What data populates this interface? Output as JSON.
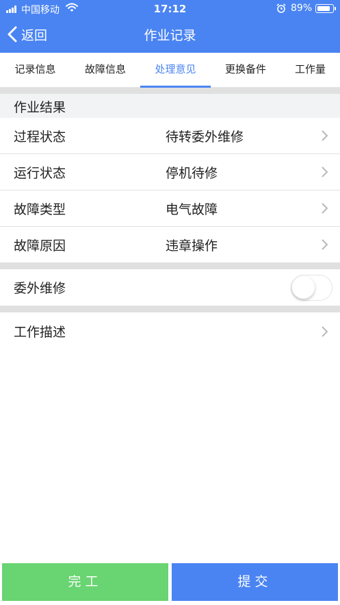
{
  "status_bar": {
    "carrier": "中国移动",
    "time": "17:12",
    "battery": "89%",
    "battery_level": 0.89
  },
  "nav": {
    "back_label": "返回",
    "title": "作业记录"
  },
  "tabs": [
    {
      "label": "记录信息",
      "active": false
    },
    {
      "label": "故障信息",
      "active": false
    },
    {
      "label": "处理意见",
      "active": true
    },
    {
      "label": "更换备件",
      "active": false
    },
    {
      "label": "工作量",
      "active": false
    }
  ],
  "work_result": {
    "header": "作业结果",
    "rows": [
      {
        "label": "过程状态",
        "value": "待转委外维修"
      },
      {
        "label": "运行状态",
        "value": "停机待修"
      },
      {
        "label": "故障类型",
        "value": "电气故障"
      },
      {
        "label": "故障原因",
        "value": "违章操作"
      }
    ]
  },
  "outsource": {
    "label": "委外维修",
    "enabled": false
  },
  "description": {
    "label": "工作描述"
  },
  "actions": {
    "finish_label": "完工",
    "submit_label": "提交"
  },
  "colors": {
    "primary": "#4a84f2",
    "finish": "#69d472",
    "divider": "#e0e0e0"
  }
}
